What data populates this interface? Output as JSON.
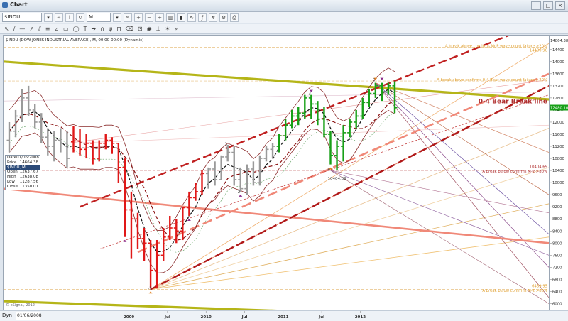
{
  "window": {
    "title": "Chart"
  },
  "toolbar": {
    "symbol": "$INDU",
    "interval": "M"
  },
  "chart_header": "$INDU (DOW JONES INDUSTRIAL AVERAGE), M, 00:00-00:00 (Dynamic)",
  "data_panel": {
    "date_label": "Date",
    "date_value": "01/06/2008",
    "price_label": "Price",
    "price_value": "14664.38",
    "series_name": "$INDU, M",
    "open_label": "Open",
    "open_value": "12637.67",
    "high_label": "High",
    "high_value": "12638.08",
    "low_label": "Low",
    "low_value": "11287.56",
    "close_label": "Close",
    "close_value": "11350.01"
  },
  "bottom_bar": {
    "dyn_label": "Dyn",
    "date_box": "01/06/2008"
  },
  "copyright": "© eSignal, 2012",
  "chart_data": {
    "type": "bar",
    "title": "$INDU (DOW JONES INDUSTRIAL AVERAGE), M, 00:00-00:00 (Dynamic)",
    "y_ticks": [
      6000,
      6400,
      6800,
      7200,
      7600,
      8000,
      8400,
      8800,
      9200,
      9600,
      10000,
      10400,
      10800,
      11200,
      11600,
      12000,
      12400,
      12800,
      13200,
      13600,
      14000,
      14400,
      14800
    ],
    "ylim": [
      5800,
      14864
    ],
    "x_tick_labels": [
      "2009",
      "Jul",
      "2010",
      "Jul",
      "2011",
      "Jul",
      "2012"
    ],
    "current_price_label": "12480.10",
    "top_price_label": "14864.38",
    "bars": [
      {
        "o": 11400,
        "h": 12000,
        "l": 11000,
        "c": 11700,
        "color": "gray"
      },
      {
        "o": 11700,
        "h": 12400,
        "l": 11500,
        "c": 12200,
        "color": "gray"
      },
      {
        "o": 12200,
        "h": 13100,
        "l": 12000,
        "c": 12800,
        "color": "gray"
      },
      {
        "o": 12800,
        "h": 13200,
        "l": 12200,
        "c": 12400,
        "color": "gray"
      },
      {
        "o": 12400,
        "h": 12600,
        "l": 11800,
        "c": 12000,
        "color": "gray"
      },
      {
        "o": 12000,
        "h": 12300,
        "l": 11300,
        "c": 11500,
        "color": "gray"
      },
      {
        "o": 11500,
        "h": 11800,
        "l": 10900,
        "c": 11200,
        "color": "gray"
      },
      {
        "o": 11200,
        "h": 11700,
        "l": 10700,
        "c": 11400,
        "color": "gray"
      },
      {
        "o": 11400,
        "h": 11800,
        "l": 11000,
        "c": 11300,
        "color": "gray"
      },
      {
        "o": 11300,
        "h": 11700,
        "l": 10500,
        "c": 10800,
        "color": "gray"
      },
      {
        "o": 11350,
        "h": 11870,
        "l": 11000,
        "c": 11380,
        "color": "red"
      },
      {
        "o": 11380,
        "h": 11780,
        "l": 10900,
        "c": 11100,
        "color": "red"
      },
      {
        "o": 11100,
        "h": 11600,
        "l": 10800,
        "c": 11300,
        "color": "red"
      },
      {
        "o": 11300,
        "h": 11400,
        "l": 10600,
        "c": 10800,
        "color": "red"
      },
      {
        "o": 10800,
        "h": 11400,
        "l": 10700,
        "c": 11300,
        "color": "red"
      },
      {
        "o": 11300,
        "h": 11600,
        "l": 11100,
        "c": 11400,
        "color": "red"
      },
      {
        "o": 11400,
        "h": 11500,
        "l": 10950,
        "c": 11300,
        "color": "red"
      },
      {
        "o": 11300,
        "h": 11300,
        "l": 10000,
        "c": 10500,
        "color": "red"
      },
      {
        "o": 10500,
        "h": 10800,
        "l": 8200,
        "c": 9100,
        "color": "red"
      },
      {
        "o": 9100,
        "h": 9700,
        "l": 7500,
        "c": 8800,
        "color": "red"
      },
      {
        "o": 8800,
        "h": 9000,
        "l": 7800,
        "c": 8150,
        "color": "red"
      },
      {
        "o": 8150,
        "h": 8500,
        "l": 7400,
        "c": 8000,
        "color": "red"
      },
      {
        "o": 8000,
        "h": 8100,
        "l": 6500,
        "c": 7100,
        "color": "red"
      },
      {
        "o": 7100,
        "h": 8100,
        "l": 6500,
        "c": 7600,
        "color": "red"
      },
      {
        "o": 7600,
        "h": 8500,
        "l": 7400,
        "c": 8200,
        "color": "red"
      },
      {
        "o": 8200,
        "h": 8900,
        "l": 8100,
        "c": 8500,
        "color": "red"
      },
      {
        "o": 8500,
        "h": 8800,
        "l": 8000,
        "c": 8400,
        "color": "red"
      },
      {
        "o": 8400,
        "h": 9200,
        "l": 8100,
        "c": 9170,
        "color": "red"
      },
      {
        "o": 9170,
        "h": 9700,
        "l": 8900,
        "c": 9500,
        "color": "red"
      },
      {
        "o": 9500,
        "h": 10000,
        "l": 9400,
        "c": 9700,
        "color": "red"
      },
      {
        "o": 9700,
        "h": 10400,
        "l": 9600,
        "c": 10300,
        "color": "red"
      },
      {
        "o": 10300,
        "h": 10500,
        "l": 9800,
        "c": 10450,
        "color": "gray"
      },
      {
        "o": 10450,
        "h": 10700,
        "l": 9900,
        "c": 10100,
        "color": "gray"
      },
      {
        "o": 10100,
        "h": 10900,
        "l": 10100,
        "c": 10850,
        "color": "gray"
      },
      {
        "o": 10850,
        "h": 11250,
        "l": 10700,
        "c": 11000,
        "color": "gray"
      },
      {
        "o": 11000,
        "h": 11200,
        "l": 9900,
        "c": 10100,
        "color": "gray"
      },
      {
        "o": 10100,
        "h": 10500,
        "l": 9700,
        "c": 9800,
        "color": "gray"
      },
      {
        "o": 9800,
        "h": 10600,
        "l": 9600,
        "c": 10450,
        "color": "gray"
      },
      {
        "o": 10450,
        "h": 10700,
        "l": 9900,
        "c": 10000,
        "color": "gray"
      },
      {
        "o": 10000,
        "h": 10900,
        "l": 9900,
        "c": 10800,
        "color": "gray"
      },
      {
        "o": 10800,
        "h": 11200,
        "l": 10700,
        "c": 11100,
        "color": "gray"
      },
      {
        "o": 11100,
        "h": 11300,
        "l": 10800,
        "c": 11200,
        "color": "gray"
      },
      {
        "o": 11200,
        "h": 11600,
        "l": 11000,
        "c": 11550,
        "color": "green"
      },
      {
        "o": 11550,
        "h": 12100,
        "l": 11400,
        "c": 11900,
        "color": "green"
      },
      {
        "o": 11900,
        "h": 12400,
        "l": 11800,
        "c": 12200,
        "color": "green"
      },
      {
        "o": 12200,
        "h": 12500,
        "l": 11900,
        "c": 12300,
        "color": "green"
      },
      {
        "o": 12300,
        "h": 12900,
        "l": 12100,
        "c": 12800,
        "color": "green"
      },
      {
        "o": 12800,
        "h": 12900,
        "l": 12100,
        "c": 12600,
        "color": "green"
      },
      {
        "o": 12600,
        "h": 12700,
        "l": 11900,
        "c": 12100,
        "color": "green"
      },
      {
        "o": 12100,
        "h": 12500,
        "l": 11500,
        "c": 11600,
        "color": "green"
      },
      {
        "o": 11600,
        "h": 11700,
        "l": 10600,
        "c": 10900,
        "color": "green"
      },
      {
        "o": 10900,
        "h": 11400,
        "l": 10400,
        "c": 11200,
        "color": "green"
      },
      {
        "o": 11200,
        "h": 11900,
        "l": 10700,
        "c": 11650,
        "color": "green"
      },
      {
        "o": 11650,
        "h": 12100,
        "l": 11500,
        "c": 12000,
        "color": "green"
      },
      {
        "o": 12000,
        "h": 12400,
        "l": 11800,
        "c": 12200,
        "color": "green"
      },
      {
        "o": 12200,
        "h": 12800,
        "l": 12100,
        "c": 12650,
        "color": "green"
      },
      {
        "o": 12650,
        "h": 13100,
        "l": 12500,
        "c": 12950,
        "color": "green"
      },
      {
        "o": 12950,
        "h": 13300,
        "l": 12800,
        "c": 13200,
        "color": "green"
      },
      {
        "o": 13200,
        "h": 13300,
        "l": 12700,
        "c": 13000,
        "color": "green"
      },
      {
        "o": 13000,
        "h": 13300,
        "l": 12900,
        "c": 13200,
        "color": "green"
      },
      {
        "o": 13200,
        "h": 13350,
        "l": 12300,
        "c": 12480,
        "color": "green"
      }
    ],
    "pivot_labels": [
      {
        "i": 22,
        "v": 6470,
        "text": "-1"
      },
      {
        "i": 34,
        "v": 11250,
        "text": "1"
      },
      {
        "i": 36,
        "v": 9650,
        "text": "2"
      },
      {
        "i": 47,
        "v": 12900,
        "text": "3"
      },
      {
        "i": 50,
        "v": 10400,
        "text": "4"
      },
      {
        "i": 50,
        "v": 10100,
        "text": "10404.69"
      },
      {
        "i": 57,
        "v": 13350,
        "text": "5"
      }
    ],
    "annotations": [
      {
        "v": 14480,
        "text": "A break above confirms MoP wave count failure >20%",
        "color": "#e0a030"
      },
      {
        "v": 14330,
        "text": "14480.96",
        "color": "#e0a030"
      },
      {
        "v": 13360,
        "text": "A break above confirms 0-4 Bear wave count failure >20%",
        "color": "#e0a030"
      },
      {
        "v": 12620,
        "text": "0-4 Bear Break line",
        "color": "#b03030",
        "big": true
      },
      {
        "v": 10490,
        "text": "10404.69",
        "color": "#b03030"
      },
      {
        "v": 10330,
        "text": "A break below confirms M-2 >80%",
        "color": "#b03030"
      },
      {
        "v": 6540,
        "text": "6469.95",
        "color": "#e0a030"
      },
      {
        "v": 6390,
        "text": "A break below confirms M-2 >80%",
        "color": "#e0a030"
      }
    ]
  }
}
